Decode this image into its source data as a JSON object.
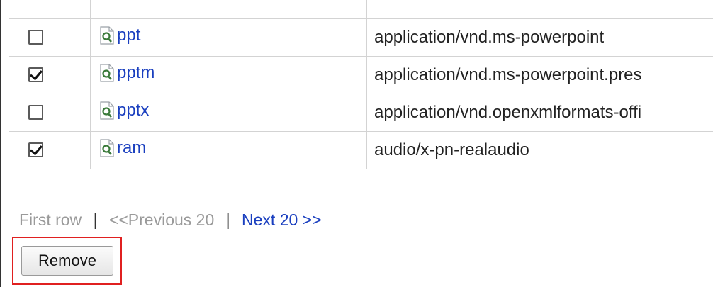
{
  "rows": [
    {
      "checked": false,
      "ext": "ppt",
      "mime": "application/vnd.ms-powerpoint"
    },
    {
      "checked": true,
      "ext": "pptm",
      "mime": "application/vnd.ms-powerpoint.pres"
    },
    {
      "checked": false,
      "ext": "pptx",
      "mime": "application/vnd.openxmlformats-offi"
    },
    {
      "checked": true,
      "ext": "ram",
      "mime": "audio/x-pn-realaudio"
    }
  ],
  "pager": {
    "first": "First row",
    "separator": "|",
    "previous": "<<Previous 20",
    "next": "Next 20 >>"
  },
  "actions": {
    "remove_label": "Remove"
  },
  "colors": {
    "link": "#1a3fbf",
    "highlight": "#e02020",
    "disabled_text": "#9a9a9a"
  },
  "icons": {
    "file_preview": "file-magnifier-icon"
  }
}
